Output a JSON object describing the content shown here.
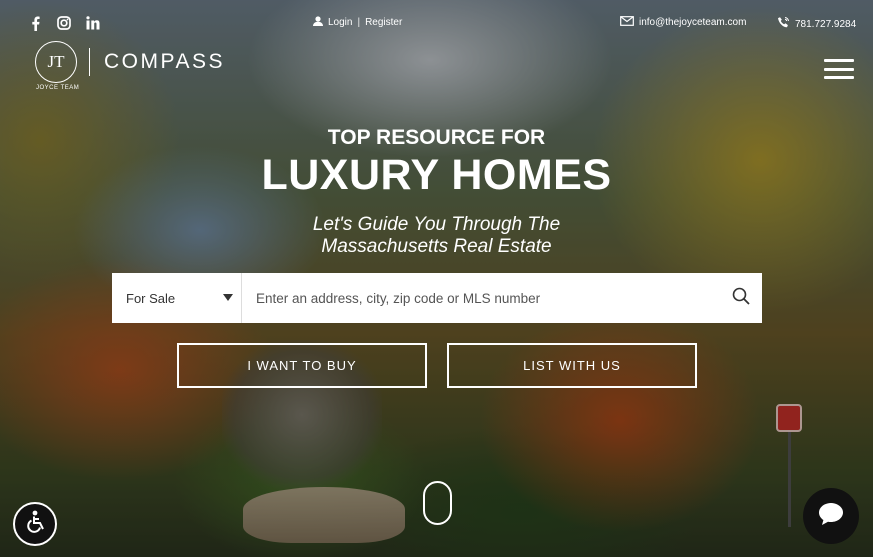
{
  "topbar": {
    "social": [
      "facebook-icon",
      "instagram-icon",
      "linkedin-icon"
    ],
    "login": "Login",
    "separator": "|",
    "register": "Register",
    "email": "info@thejoyceteam.com",
    "phone": "781.727.9284"
  },
  "logo": {
    "mark": "JT",
    "sub": "JOYCE TEAM",
    "brand": "COMPASS"
  },
  "hero": {
    "kicker": "TOP RESOURCE FOR",
    "headline": "LUXURY HOMES",
    "subline_1": "Let's Guide You Through The",
    "subline_2": "Massachusetts Real Estate"
  },
  "search": {
    "type_selected": "For Sale",
    "placeholder": "Enter an address, city, zip code or MLS number"
  },
  "cta": {
    "buy": "I WANT TO BUY",
    "list": "LIST WITH US"
  },
  "colors": {
    "text": "#ffffff",
    "button_bg": "#111111",
    "search_bg": "#ffffff"
  }
}
